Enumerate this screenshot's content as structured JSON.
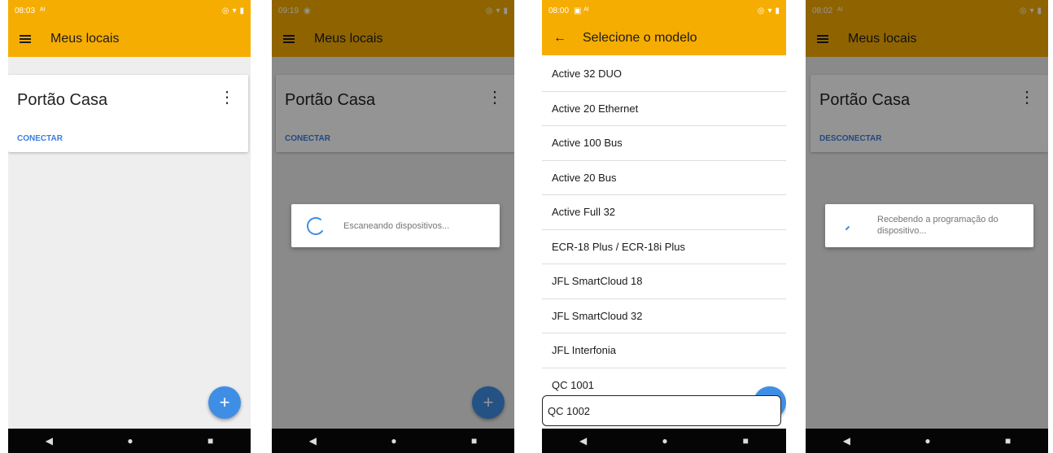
{
  "screens": [
    {
      "status_time": "08:03",
      "app_title": "Meus locais",
      "card": {
        "name": "Portão Casa",
        "action": "CONECTAR"
      },
      "fab": "+"
    },
    {
      "status_time": "09:19",
      "app_title": "Meus locais",
      "card": {
        "name": "Portão Casa",
        "action": "CONECTAR"
      },
      "dialog_message": "Escaneando dispositivos...",
      "fab": "+"
    },
    {
      "status_time": "08:00",
      "app_title": "Selecione o modelo",
      "models": [
        "Active 32 DUO",
        "Active 20 Ethernet",
        "Active 100 Bus",
        "Active 20 Bus",
        "Active Full 32",
        "ECR-18 Plus / ECR-18i Plus",
        "JFL SmartCloud 18",
        "JFL SmartCloud 32",
        "JFL Interfonia",
        "QC 1001",
        "QC 1002"
      ],
      "fab": "+"
    },
    {
      "status_time": "08:02",
      "app_title": "Meus locais",
      "card": {
        "name": "Portão Casa",
        "action": "DESCONECTAR"
      },
      "dialog_message": "Recebendo a programação do dispositivo..."
    }
  ],
  "nav": {
    "back": "◀",
    "home": "●",
    "recents": "■"
  },
  "colors": {
    "accent": "#f6ad01",
    "fab": "#3f8ee6",
    "link": "#3b7de0"
  }
}
